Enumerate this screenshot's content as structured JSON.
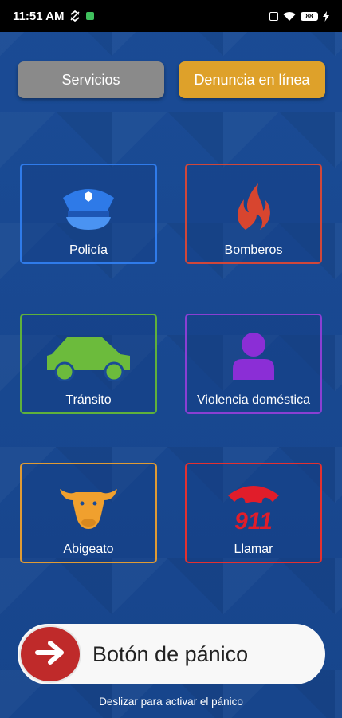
{
  "status_bar": {
    "time": "11:51 AM",
    "battery": "88",
    "icons": [
      "signal-icon",
      "sync-icon",
      "app-notification-icon",
      "screen-icon",
      "wifi-icon",
      "battery-icon",
      "charging-icon"
    ]
  },
  "top_buttons": {
    "servicios": "Servicios",
    "denuncia": "Denuncia en línea"
  },
  "cards": [
    {
      "label": "Policía",
      "icon": "police-cap-icon",
      "border": "#2f7bea"
    },
    {
      "label": "Bomberos",
      "icon": "flame-icon",
      "border": "#d0473a"
    },
    {
      "label": "Tránsito",
      "icon": "car-icon",
      "border": "#5fb13b"
    },
    {
      "label": "Violencia doméstica",
      "icon": "person-icon",
      "border": "#8a3fd3"
    },
    {
      "label": "Abigeato",
      "icon": "cow-head-icon",
      "border": "#e09b34"
    },
    {
      "label": "Llamar",
      "icon": "phone-911-icon",
      "border": "#e33130"
    }
  ],
  "icon_text": {
    "emergency_number": "911"
  },
  "panic": {
    "label": "Botón de pánico",
    "hint": "Deslizar para activar el pánico"
  },
  "colors": {
    "background": "#17468f",
    "servicios": "#8a8a8a",
    "denuncia": "#dea12a",
    "panic_knob": "#bf2a2a"
  }
}
